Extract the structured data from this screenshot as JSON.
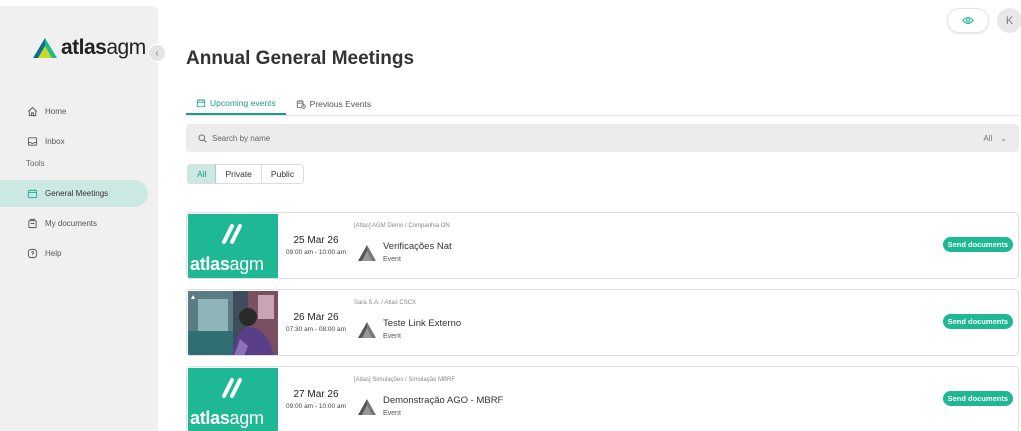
{
  "brand": {
    "name_bold": "atlas",
    "name_light": "agm"
  },
  "colors": {
    "accent": "#1fb894",
    "accent_text": "#1a9e85",
    "active_bg": "#cce8e2",
    "sidebar_bg": "#f0f0f0"
  },
  "sidebar": {
    "collapse_icon": "chevron-left-icon",
    "items_top": [
      {
        "label": "Home",
        "icon": "home-icon"
      },
      {
        "label": "Inbox",
        "icon": "inbox-icon"
      }
    ],
    "section_label": "Tools",
    "items_tools": [
      {
        "label": "General Meetings",
        "icon": "calendar-icon",
        "active": true
      },
      {
        "label": "My documents",
        "icon": "documents-icon"
      },
      {
        "label": "Help",
        "icon": "help-icon"
      }
    ]
  },
  "topbar": {
    "eye_icon": "eye-icon",
    "avatar_initial": "K"
  },
  "page": {
    "title": "Annual General Meetings"
  },
  "tabs": [
    {
      "label": "Upcoming events",
      "icon": "calendar-icon",
      "active": true
    },
    {
      "label": "Previous Events",
      "icon": "calendar-clock-icon",
      "active": false
    }
  ],
  "search": {
    "placeholder": "Search by name",
    "filter_value": "All"
  },
  "segments": [
    {
      "label": "All",
      "active": true
    },
    {
      "label": "Private",
      "active": false
    },
    {
      "label": "Public",
      "active": false
    }
  ],
  "events": [
    {
      "thumb": "brand",
      "date": "25 Mar 26",
      "time": "09:00 am - 10:00 am",
      "company": "[Atlas] AGM Demo / Companhia ON",
      "name": "Verificações Nat",
      "type": "Event",
      "action": "Send documents"
    },
    {
      "thumb": "photo",
      "date": "26 Mar 26",
      "time": "07:30 am - 08:00 am",
      "company": "Sara S.A. / Atlas CSCX",
      "name": "Teste Link Externo",
      "type": "Event",
      "action": "Send documents"
    },
    {
      "thumb": "brand",
      "date": "27 Mar 26",
      "time": "09:00 am - 10:00 am",
      "company": "[Atlas] Simulações / Simulação MBRF",
      "name": "Demonstração AGO - MBRF",
      "type": "Event",
      "action": "Send documents"
    }
  ]
}
